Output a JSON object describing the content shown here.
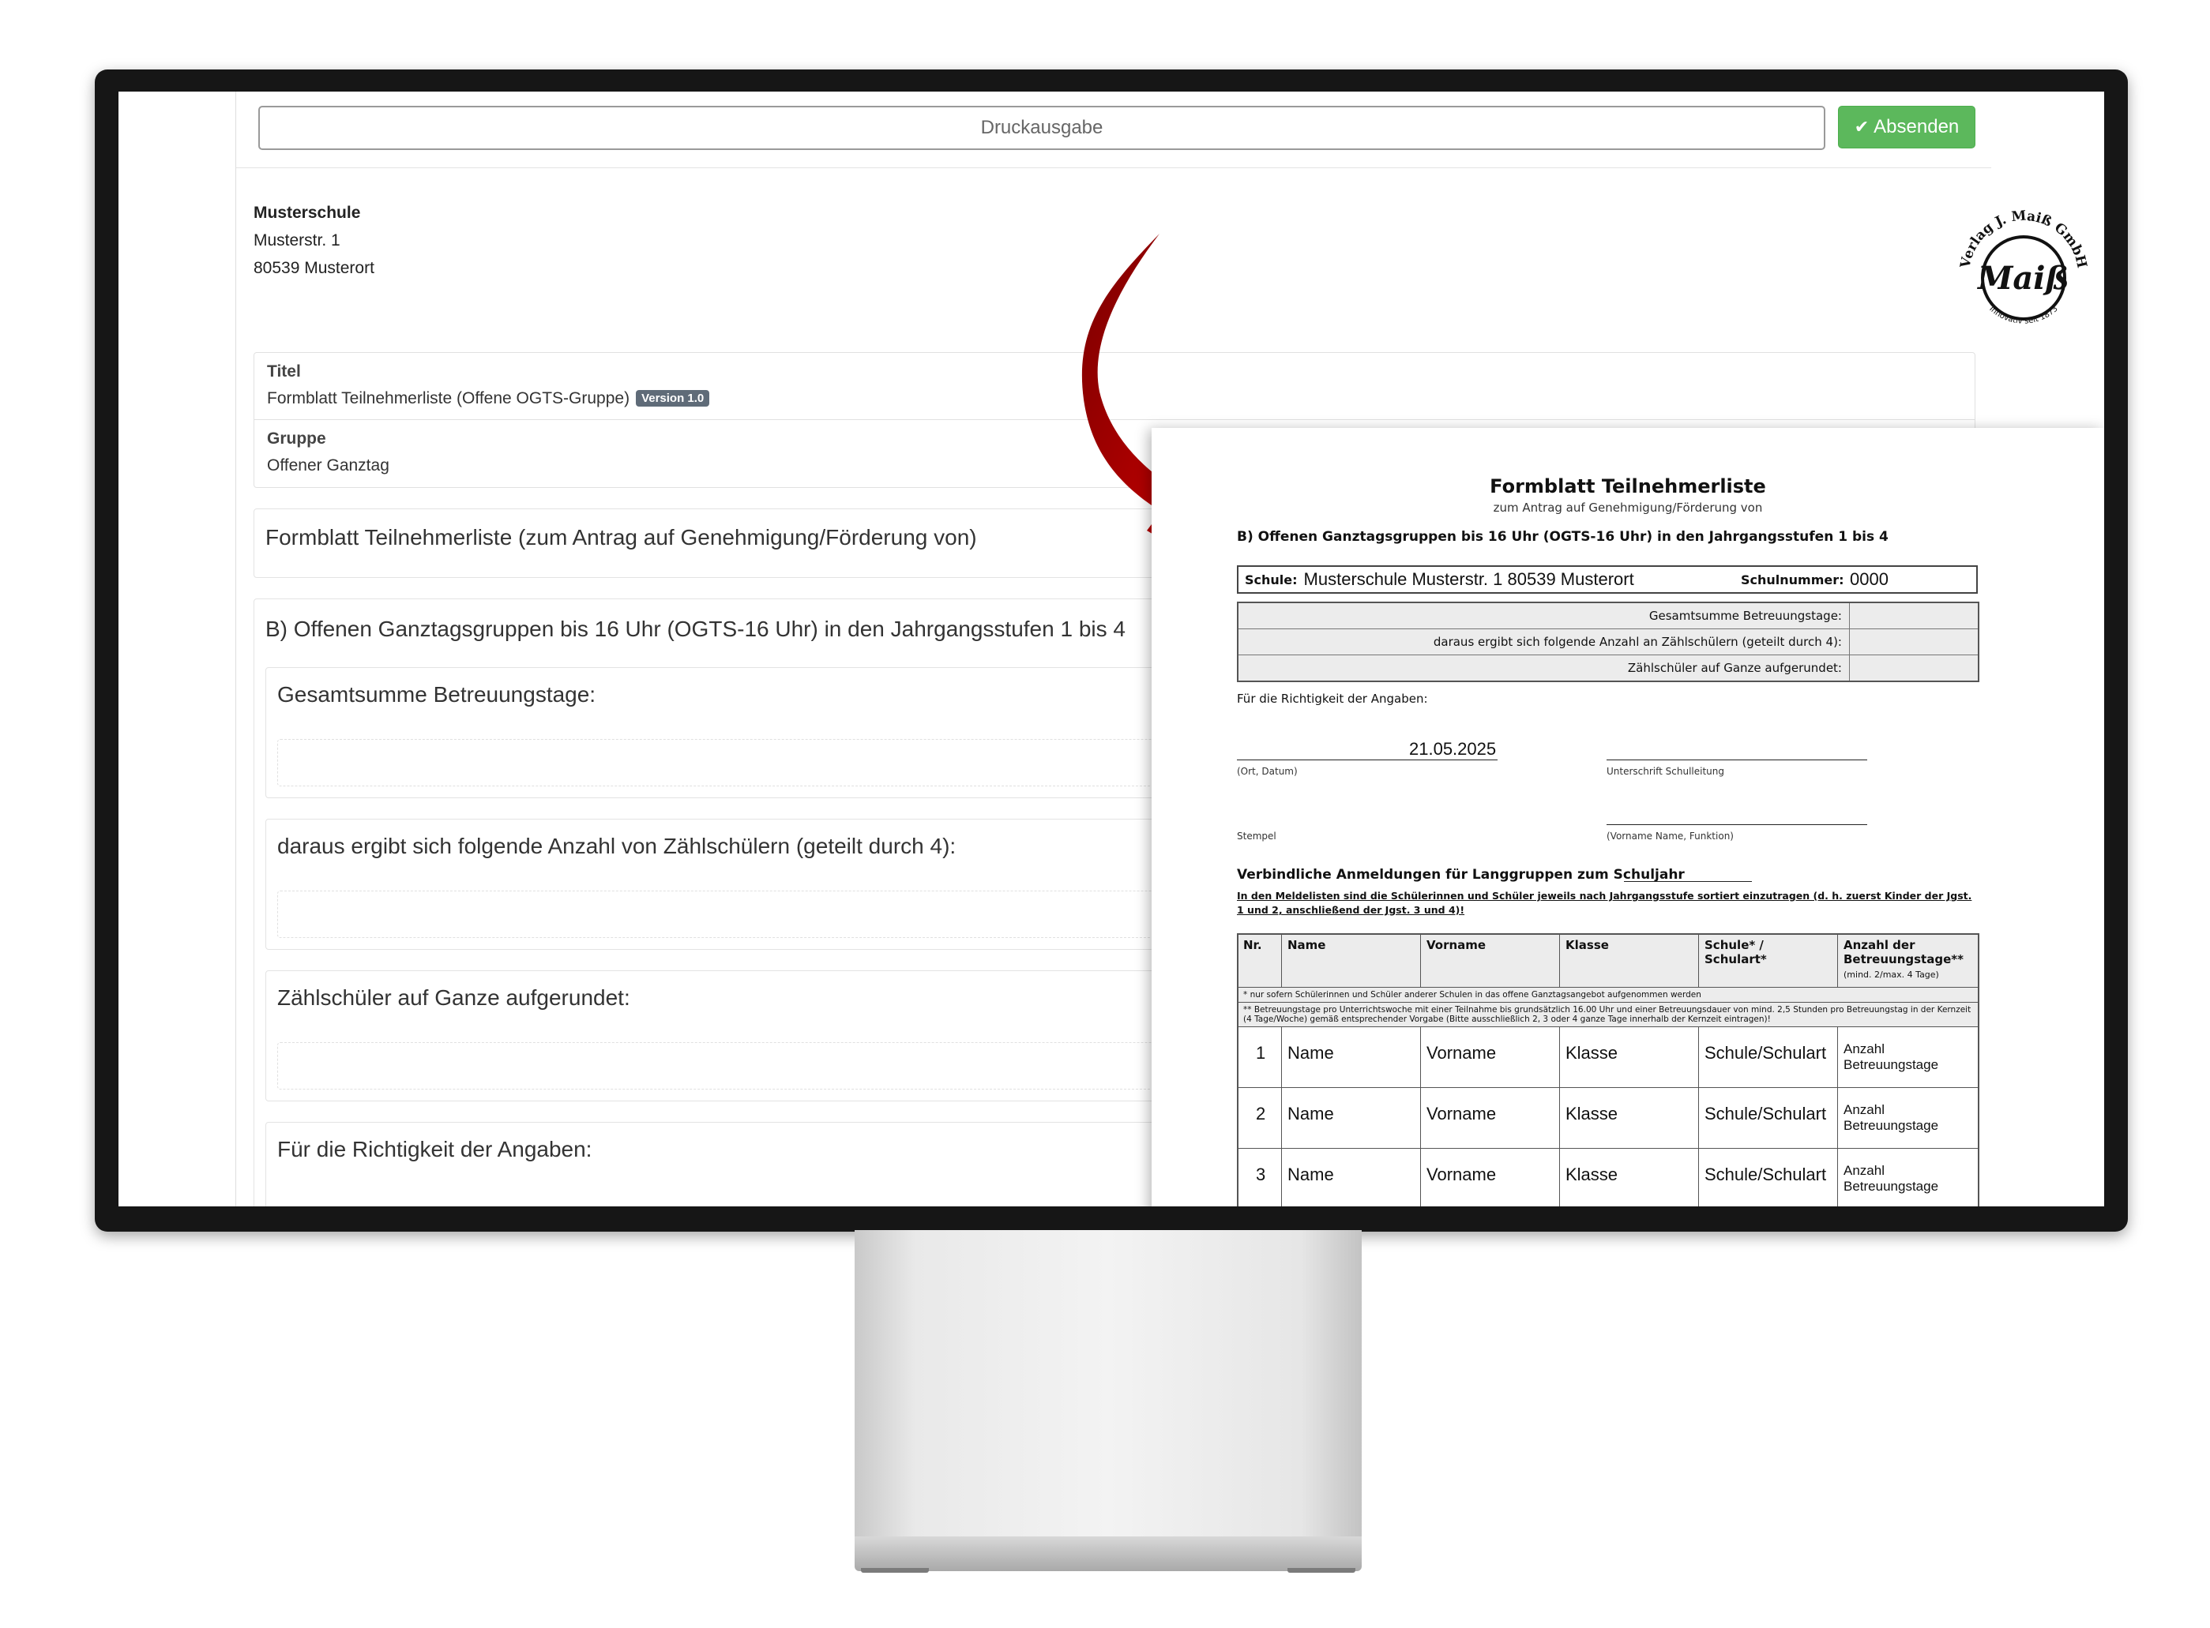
{
  "toolbar": {
    "print_label": "Druckausgabe",
    "send_label": "Absenden",
    "send_icon": "check-icon"
  },
  "address": {
    "school": "Musterschule",
    "street": "Musterstr. 1",
    "city": "80539 Musterort"
  },
  "logo": {
    "arc_top": "Verlag J. Maiß GmbH",
    "script": "Maiß",
    "arc_bottom": "Innovativ seit 1873"
  },
  "meta": {
    "title_label": "Titel",
    "title_value": "Formblatt Teilnehmerliste (Offene OGTS-Gruppe)",
    "version_badge": "Version 1.0",
    "group_label": "Gruppe",
    "group_value": "Offener Ganztag"
  },
  "form": {
    "heading": "Formblatt Teilnehmerliste (zum Antrag auf Genehmigung/Förderung von)",
    "section_title": "B) Offenen Ganztagsgruppen bis 16 Uhr (OGTS-16 Uhr) in den Jahrgangsstufen 1 bis 4",
    "field1": "Gesamtsumme Betreuungstage:",
    "field2": "daraus ergibt sich folgende Anzahl von Zählschülern (geteilt durch 4):",
    "field3": "Zählschüler auf Ganze aufgerundet:",
    "field4": "Für die Richtigkeit der Angaben:"
  },
  "doc": {
    "title": "Formblatt Teilnehmerliste",
    "subtitle": "zum Antrag auf Genehmigung/Förderung von",
    "section": "B) Offenen Ganztagsgruppen bis 16 Uhr (OGTS-16 Uhr) in den Jahrgangsstufen 1 bis 4",
    "school_label": "Schule:",
    "school_value": "Musterschule Musterstr. 1 80539 Musterort",
    "nr_label": "Schulnummer:",
    "nr_value": "0000",
    "sum_rows": [
      "Gesamtsumme Betreuungstage:",
      "daraus ergibt sich folgende Anzahl an Zählschülern (geteilt durch 4):",
      "Zählschüler auf Ganze aufgerundet:"
    ],
    "richtigkeit": "Für die Richtigkeit der Angaben:",
    "date": "21.05.2025",
    "ort_datum": "(Ort, Datum)",
    "unterschrift": "Unterschrift Schulleitung",
    "stempel": "Stempel",
    "vorname_funktion": "(Vorname Name, Funktion)",
    "verbindlich": "Verbindliche Anmeldungen für Langgruppen zum Schuljahr",
    "hint": "In den Meldelisten sind die Schülerinnen und Schüler jeweils nach Jahrgangsstufe sortiert einzutragen (d. h. zuerst Kinder der Jgst. 1 und 2, anschließend der Jgst. 3 und 4)!",
    "headers": {
      "nr": "Nr.",
      "name": "Name",
      "vorname": "Vorname",
      "klasse": "Klasse",
      "schule": "Schule* /",
      "schulart": "Schulart*",
      "anzahl": "Anzahl der",
      "betreuung": "Betreuungstage**",
      "mind": "(mind. 2/max. 4 Tage)"
    },
    "note1": "* nur sofern Schülerinnen und Schüler anderer Schulen in das offene Ganztagsangebot aufgenommen werden",
    "note2": "** Betreuungstage pro Unterrichtswoche mit einer Teilnahme bis grundsätzlich 16.00 Uhr und einer Betreuungsdauer von mind. 2,5 Stunden pro Betreuungstag in der Kernzeit (4 Tage/Woche) gemäß entsprechender Vorgabe (Bitte ausschließlich 2, 3 oder 4 ganze Tage innerhalb der Kernzeit eintragen)!",
    "rows": [
      {
        "nr": "1",
        "name": "Name",
        "vorname": "Vorname",
        "klasse": "Klasse",
        "schule": "Schule/Schulart",
        "anz1": "Anzahl",
        "anz2": "Betreuungstage"
      },
      {
        "nr": "2",
        "name": "Name",
        "vorname": "Vorname",
        "klasse": "Klasse",
        "schule": "Schule/Schulart",
        "anz1": "Anzahl",
        "anz2": "Betreuungstage"
      },
      {
        "nr": "3",
        "name": "Name",
        "vorname": "Vorname",
        "klasse": "Klasse",
        "schule": "Schule/Schulart",
        "anz1": "Anzahl",
        "anz2": "Betreuungstage"
      }
    ]
  },
  "colors": {
    "accent_green": "#5cb85c",
    "arrow_red": "#c80000",
    "badge": "#5f6b78"
  }
}
